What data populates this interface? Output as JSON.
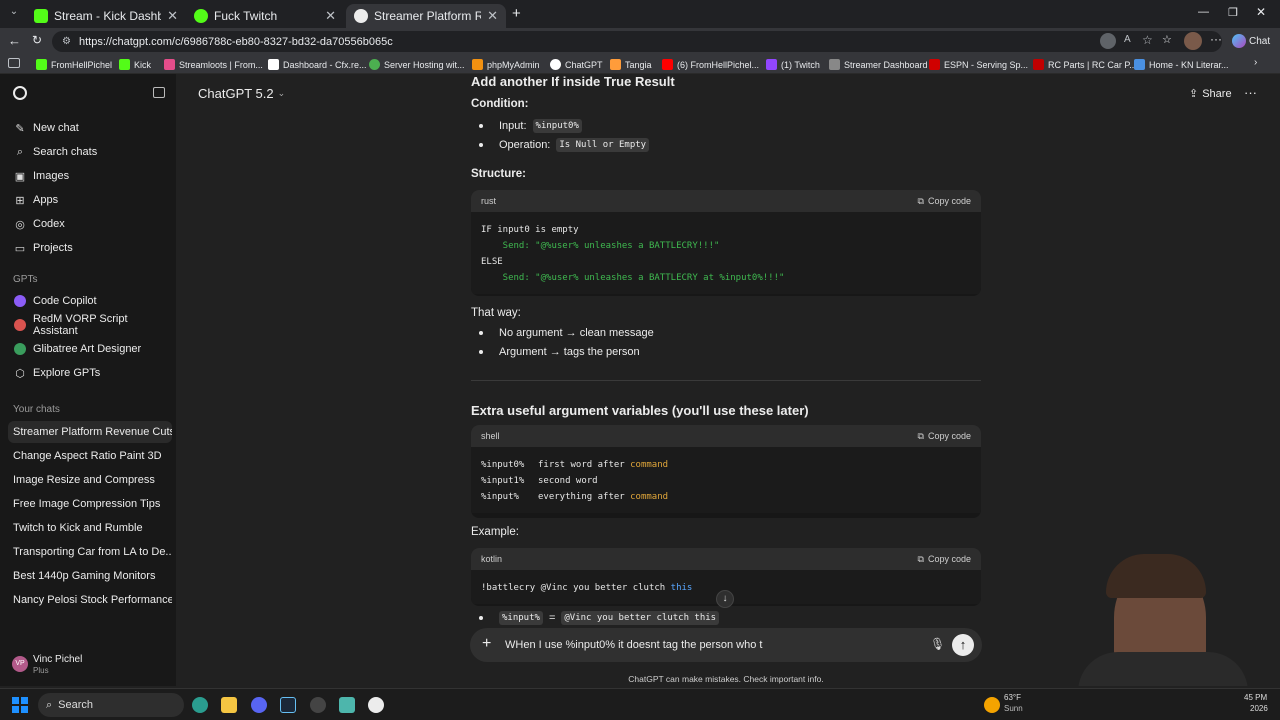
{
  "browser": {
    "tabs": [
      {
        "label": "Stream - Kick Dashboard",
        "color": "#53fc18",
        "active": false
      },
      {
        "label": "Fuck Twitch",
        "color": "#53fc18",
        "active": false
      },
      {
        "label": "Streamer Platform Revenue Cuts",
        "color": "#ececec",
        "active": true
      }
    ],
    "url": "https://chatgpt.com/c/6986788c-eb80-8327-bd32-da70556b065c",
    "bookmarks": [
      {
        "label": "FromHellPichel",
        "color": "#53fc18"
      },
      {
        "label": "Kick",
        "color": "#53fc18"
      },
      {
        "label": "Streamloots | From...",
        "color": "#e44d8a"
      },
      {
        "label": "Dashboard - Cfx.re...",
        "color": "#ffffff"
      },
      {
        "label": "Server Hosting wit...",
        "color": "#4caf50"
      },
      {
        "label": "phpMyAdmin",
        "color": "#f29111"
      },
      {
        "label": "ChatGPT",
        "color": "#ffffff"
      },
      {
        "label": "Tangia",
        "color": "#ff9c3a"
      },
      {
        "label": "(6) FromHellPichel...",
        "color": "#ff0000"
      },
      {
        "label": "(1) Twitch",
        "color": "#9146ff"
      },
      {
        "label": "Streamer Dashboard",
        "color": "#888888"
      },
      {
        "label": "ESPN - Serving Sp...",
        "color": "#d00000"
      },
      {
        "label": "RC Parts | RC Car P...",
        "color": "#c00000"
      },
      {
        "label": "Home - KN Literar...",
        "color": "#4a90e2"
      }
    ],
    "chat_button": "Chat"
  },
  "sidebar": {
    "top_items": [
      {
        "label": "New chat",
        "icon": "edit-icon"
      },
      {
        "label": "Search chats",
        "icon": "search-icon"
      },
      {
        "label": "Images",
        "icon": "image-icon"
      },
      {
        "label": "Apps",
        "icon": "apps-icon"
      },
      {
        "label": "Codex",
        "icon": "codex-icon"
      },
      {
        "label": "Projects",
        "icon": "folder-icon"
      }
    ],
    "gpts_heading": "GPTs",
    "gpts": [
      {
        "label": "Code Copilot",
        "color": "#8b5cf6"
      },
      {
        "label": "RedM VORP Script Assistant",
        "color": "#d9534f"
      },
      {
        "label": "Glibatree Art Designer",
        "color": "#3a9d5d"
      },
      {
        "label": "Explore GPTs",
        "color": "#ececec"
      }
    ],
    "chats_heading": "Your chats",
    "chats": [
      "Streamer Platform Revenue Cuts",
      "Change Aspect Ratio Paint 3D",
      "Image Resize and Compress",
      "Free Image Compression Tips",
      "Twitch to Kick and Rumble",
      "Transporting Car from LA to De...",
      "Best 1440p Gaming Monitors",
      "Nancy Pelosi Stock Performance"
    ],
    "user": {
      "name": "Vinc Pichel",
      "plan": "Plus",
      "initials": "VP"
    }
  },
  "header": {
    "model": "ChatGPT 5.2",
    "share": "Share"
  },
  "content": {
    "heading1": "Add another If inside True Result",
    "condition_label": "Condition:",
    "cond_items": [
      {
        "prefix": "Input:",
        "code": "%input0%"
      },
      {
        "prefix": "Operation:",
        "code": "Is Null or Empty"
      }
    ],
    "structure_label": "Structure:",
    "code1": {
      "lang": "rust",
      "copy": "Copy code",
      "lines": [
        "IF input0 is empty",
        "    Send: \"@%user% unleashes a BATTLECRY!!!\"",
        "ELSE",
        "    Send: \"@%user% unleashes a BATTLECRY at %input0%!!!\""
      ]
    },
    "thatway_label": "That way:",
    "thatway_items": [
      "No argument → clean message",
      "Argument → tags the person"
    ],
    "heading2": "Extra useful argument variables (you'll use these later)",
    "code2": {
      "lang": "shell",
      "copy": "Copy code",
      "lines": [
        {
          "var": "%input0%",
          "desc": "first word after",
          "kw": "command"
        },
        {
          "var": "%input1%",
          "desc": "second word",
          "kw": ""
        },
        {
          "var": "%input%",
          "desc": "everything after",
          "kw": "command"
        }
      ]
    },
    "example_label": "Example:",
    "code3": {
      "lang": "kotlin",
      "copy": "Copy code",
      "text": "!battlecry @Vinc you better clutch",
      "kw": "this"
    },
    "result_line": {
      "code1": "%input%",
      "eq": "=",
      "code2": "@Vinc you better clutch this"
    }
  },
  "composer": {
    "value": "WHen I use %input0% it doesnt tag the person who t",
    "disclaimer": "ChatGPT can make mistakes. Check important info."
  },
  "taskbar": {
    "search": "Search",
    "weather": "63°F",
    "weather_sub": "Sunn",
    "time": "45 PM",
    "date": "2026"
  }
}
